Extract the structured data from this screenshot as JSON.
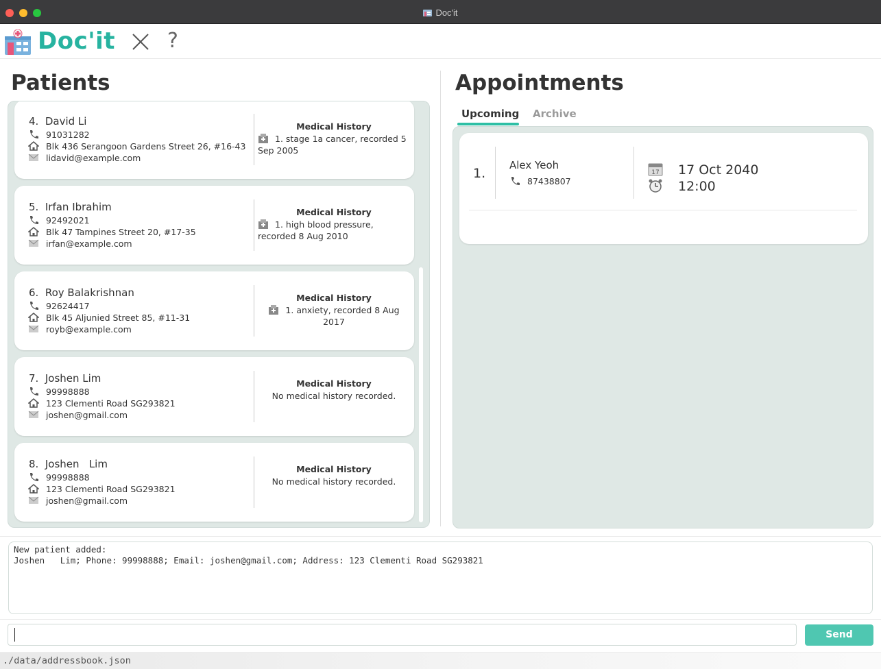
{
  "window": {
    "title": "Doc'it"
  },
  "app": {
    "logo_text": "Doc'it",
    "help_label": "?"
  },
  "patients": {
    "heading": "Patients",
    "medical_history_label": "Medical History",
    "list": [
      {
        "index": "4.",
        "name": "David Li",
        "phone": "91031282",
        "address": "Blk 436 Serangoon Gardens Street 26, #16-43",
        "email": "lidavid@example.com",
        "history": "1. stage 1a cancer, recorded 5 Sep 2005",
        "has_history": true
      },
      {
        "index": "5.",
        "name": "Irfan Ibrahim",
        "phone": "92492021",
        "address": "Blk 47 Tampines Street 20, #17-35",
        "email": "irfan@example.com",
        "history": "1. high blood pressure, recorded 8 Aug 2010",
        "has_history": true
      },
      {
        "index": "6.",
        "name": "Roy Balakrishnan",
        "phone": "92624417",
        "address": "Blk 45 Aljunied Street 85, #11-31",
        "email": "royb@example.com",
        "history": "1. anxiety, recorded 8 Aug 2017",
        "has_history": true
      },
      {
        "index": "7.",
        "name": "Joshen Lim",
        "phone": "99998888",
        "address": "123 Clementi Road SG293821",
        "email": "joshen@gmail.com",
        "history": "No medical history recorded.",
        "has_history": false
      },
      {
        "index": "8.",
        "name": "Joshen   Lim",
        "phone": "99998888",
        "address": "123 Clementi Road SG293821",
        "email": "joshen@gmail.com",
        "history": "No medical history recorded.",
        "has_history": false
      }
    ]
  },
  "appointments": {
    "heading": "Appointments",
    "tabs": [
      {
        "label": "Upcoming",
        "active": true
      },
      {
        "label": "Archive",
        "active": false
      }
    ],
    "list": [
      {
        "index": "1.",
        "name": "Alex Yeoh",
        "phone": "87438807",
        "date": "17 Oct 2040",
        "time": "12:00"
      }
    ]
  },
  "result": {
    "text": "New patient added:\nJoshen   Lim; Phone: 99998888; Email: joshen@gmail.com; Address: 123 Clementi Road SG293821"
  },
  "command": {
    "value": "",
    "send_label": "Send"
  },
  "status": {
    "path": "./data/addressbook.json"
  },
  "colors": {
    "accent": "#2fbfa5",
    "send_button": "#4fc7b1",
    "panel_bg": "#dfe8e5",
    "logo": "#27b3a0"
  }
}
